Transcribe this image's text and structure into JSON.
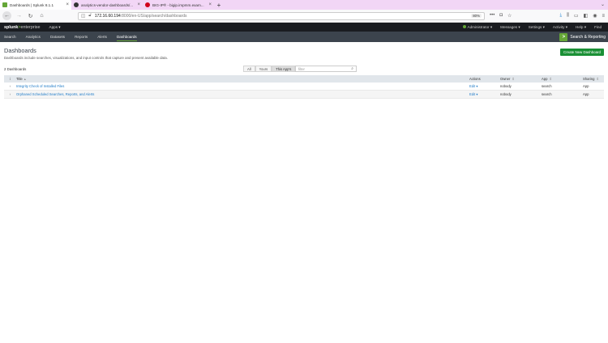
{
  "browser": {
    "tabs": [
      {
        "title": "Dashboards | Splunk 8.1.1",
        "favicon_color": "#65a637",
        "active": true
      },
      {
        "title": "analytics-vendor-dashboards/...",
        "favicon_color": "#333333",
        "active": false
      },
      {
        "title": "BIG-IP® - bigip.impmm.exam...",
        "favicon_color": "#d0021b",
        "active": false
      }
    ],
    "new_tab_label": "+",
    "url_host": "172.16.60.194",
    "url_path": ":8000/en-US/app/search/dashboards",
    "zoom": "80%"
  },
  "splunk_bar": {
    "logo_main": "splunk",
    "logo_gt": ">",
    "logo_sub": "enterprise",
    "apps_menu": "Apps ▾",
    "right_menus": [
      "Administrator ▾",
      "Messages ▾",
      "Settings ▾",
      "Activity ▾",
      "Help ▾",
      "Find"
    ]
  },
  "app_bar": {
    "nav": [
      "Search",
      "Analytics",
      "Datasets",
      "Reports",
      "Alerts",
      "Dashboards"
    ],
    "active": "Dashboards",
    "app_name": "Search & Reporting",
    "app_badge": ">"
  },
  "page": {
    "title": "Dashboards",
    "description": "Dashboards include searches, visualizations, and input controls that capture and present available data.",
    "create_button": "Create New Dashboard",
    "count_label": "2 Dashboards",
    "filters": [
      "All",
      "Yours",
      "This App's"
    ],
    "active_filter": "This App's",
    "filter_placeholder": "filter"
  },
  "table": {
    "headers": {
      "expand": "i",
      "title": "Title",
      "actions": "Actions",
      "owner": "Owner",
      "app": "App",
      "sharing": "Sharing"
    },
    "rows": [
      {
        "title": "Integrity Check of Installed Files",
        "actions": "Edit ▾",
        "owner": "nobody",
        "app": "search",
        "sharing": "App"
      },
      {
        "title": "Orphaned Scheduled Searches, Reports, and Alerts",
        "actions": "Edit ▾",
        "owner": "nobody",
        "app": "search",
        "sharing": "App"
      }
    ]
  }
}
